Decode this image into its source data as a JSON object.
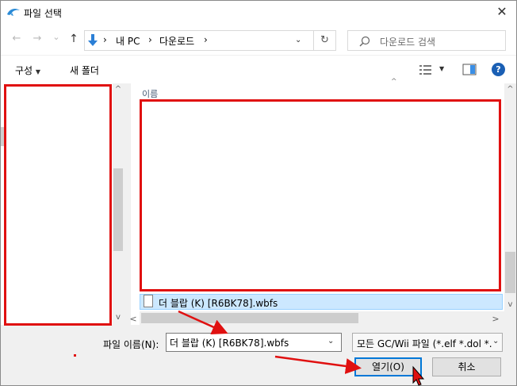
{
  "window": {
    "title": "파일 선택",
    "close_glyph": "✕"
  },
  "nav": {
    "back_glyph": "←",
    "forward_glyph": "→",
    "recent_glyph": "⌄",
    "up_glyph": "↑",
    "breadcrumb": [
      "내 PC",
      "다운로드"
    ],
    "separator": "›",
    "refresh_glyph": "↻",
    "search_placeholder": "다운로드 검색"
  },
  "toolbar": {
    "organize_label": "구성",
    "new_folder_label": "새 폴더",
    "help_glyph": "?"
  },
  "list": {
    "column_name": "이름",
    "files": [
      {
        "name": "더 블랍 (K) [R6BK78].wbfs"
      }
    ]
  },
  "footer": {
    "filename_label": "파일 이름(N):",
    "filename_value": "더 블랍 (K) [R6BK78].wbfs",
    "filter_value": "모든 GC/Wii 파일 (*.elf *.dol *.",
    "open_label": "열기(O)",
    "cancel_label": "취소"
  },
  "colors": {
    "annotation_red": "#e01010",
    "accent": "#0078d7",
    "selection": "#cce8ff"
  }
}
